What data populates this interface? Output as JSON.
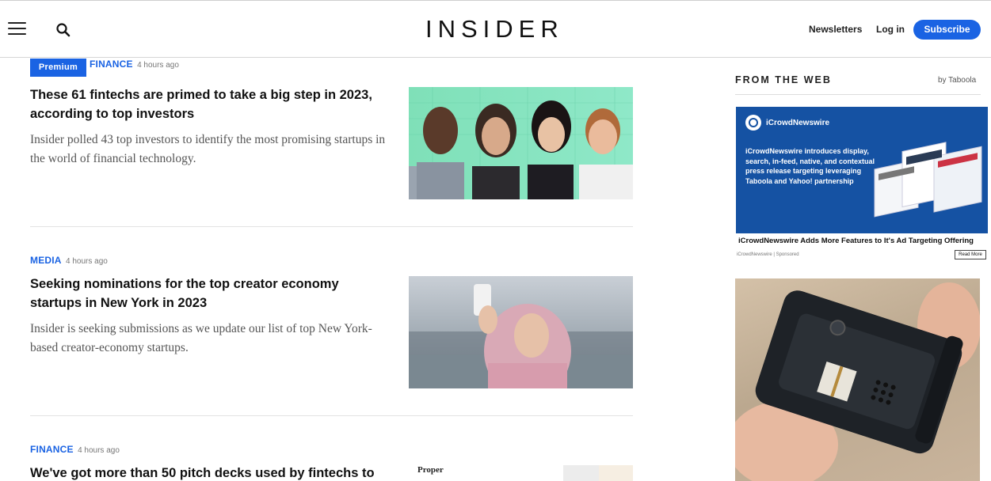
{
  "header": {
    "logo": "INSIDER",
    "menu_icon": "hamburger-menu-icon",
    "search_icon": "search-icon",
    "newsletters_label": "Newsletters",
    "login_label": "Log in",
    "subscribe_label": "Subscribe",
    "accent_color": "#1a63e3"
  },
  "articles": [
    {
      "badge": "Premium",
      "category": "FINANCE",
      "time": "4 hours ago",
      "headline": "These 61 fintechs are primed to take a big step in 2023, according to top investors",
      "dek": "Insider polled 43 top investors to identify the most promising startups in the world of financial technology."
    },
    {
      "category": "MEDIA",
      "time": "4 hours ago",
      "headline": "Seeking nominations for the top creator economy startups in New York in 2023",
      "dek": "Insider is seeking submissions as we update our list of top New York-based creator-economy startups."
    },
    {
      "category": "FINANCE",
      "time": "4 hours ago",
      "headline": "We've got more than 50 pitch decks used by fintechs to",
      "thumb_text": "Proper"
    }
  ],
  "rail": {
    "title": "FROM THE WEB",
    "by": "by Taboola",
    "ad1": {
      "brand": "iCrowdNewswire",
      "copy": "iCrowdNewswire introduces display, search, in-feed, native, and contextual press release targeting leveraging Taboola and Yahoo! partnership",
      "caption": "iCrowdNewswire Adds More Features to It's Ad Targeting Offering",
      "source": "iCrowdNewswire | Sponsored",
      "read_more": "Read More"
    }
  }
}
